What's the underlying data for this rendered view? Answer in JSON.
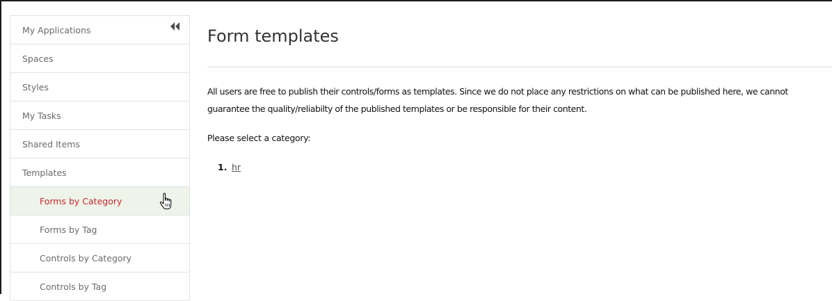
{
  "sidebar": {
    "items": [
      {
        "label": "My Applications"
      },
      {
        "label": "Spaces"
      },
      {
        "label": "Styles"
      },
      {
        "label": "My Tasks"
      },
      {
        "label": "Shared Items"
      },
      {
        "label": "Templates"
      },
      {
        "label": "Forms by Category",
        "active": true
      },
      {
        "label": "Forms by Tag"
      },
      {
        "label": "Controls by Category"
      },
      {
        "label": "Controls by Tag"
      }
    ],
    "collapse_icon": "double-chevron-left-icon"
  },
  "main": {
    "title": "Form templates",
    "disclaimer": "All users are free to publish their controls/forms as templates. Since we do not place any restrictions on what can be published here, we cannot guarantee the quality/reliabilty of the published templates or be responsible for their content.",
    "prompt": "Please select a category:",
    "categories": [
      {
        "number": "1.",
        "label": "hr"
      }
    ]
  },
  "colors": {
    "active_text": "#c8262e",
    "active_bg": "#eef4ea",
    "sidebar_text": "#6a6a6a",
    "border": "#e3e3e3"
  },
  "cursor_icon": "hand-pointer-icon"
}
